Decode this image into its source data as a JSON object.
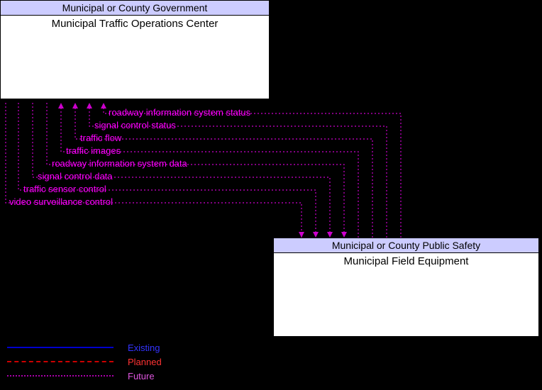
{
  "boxes": {
    "top": {
      "header": "Municipal or County Government",
      "body": "Municipal Traffic Operations Center"
    },
    "bottom": {
      "header": "Municipal or County Public Safety",
      "body": "Municipal Field Equipment"
    }
  },
  "flows": [
    {
      "label": "roadway information system status",
      "dir": "up"
    },
    {
      "label": "signal control status",
      "dir": "up"
    },
    {
      "label": "traffic flow",
      "dir": "up"
    },
    {
      "label": "traffic images",
      "dir": "up"
    },
    {
      "label": "roadway information system data",
      "dir": "down"
    },
    {
      "label": "signal control data",
      "dir": "down"
    },
    {
      "label": "traffic sensor control",
      "dir": "down"
    },
    {
      "label": "video surveillance control",
      "dir": "down"
    }
  ],
  "legend": {
    "existing": "Existing",
    "planned": "Planned",
    "future": "Future"
  }
}
